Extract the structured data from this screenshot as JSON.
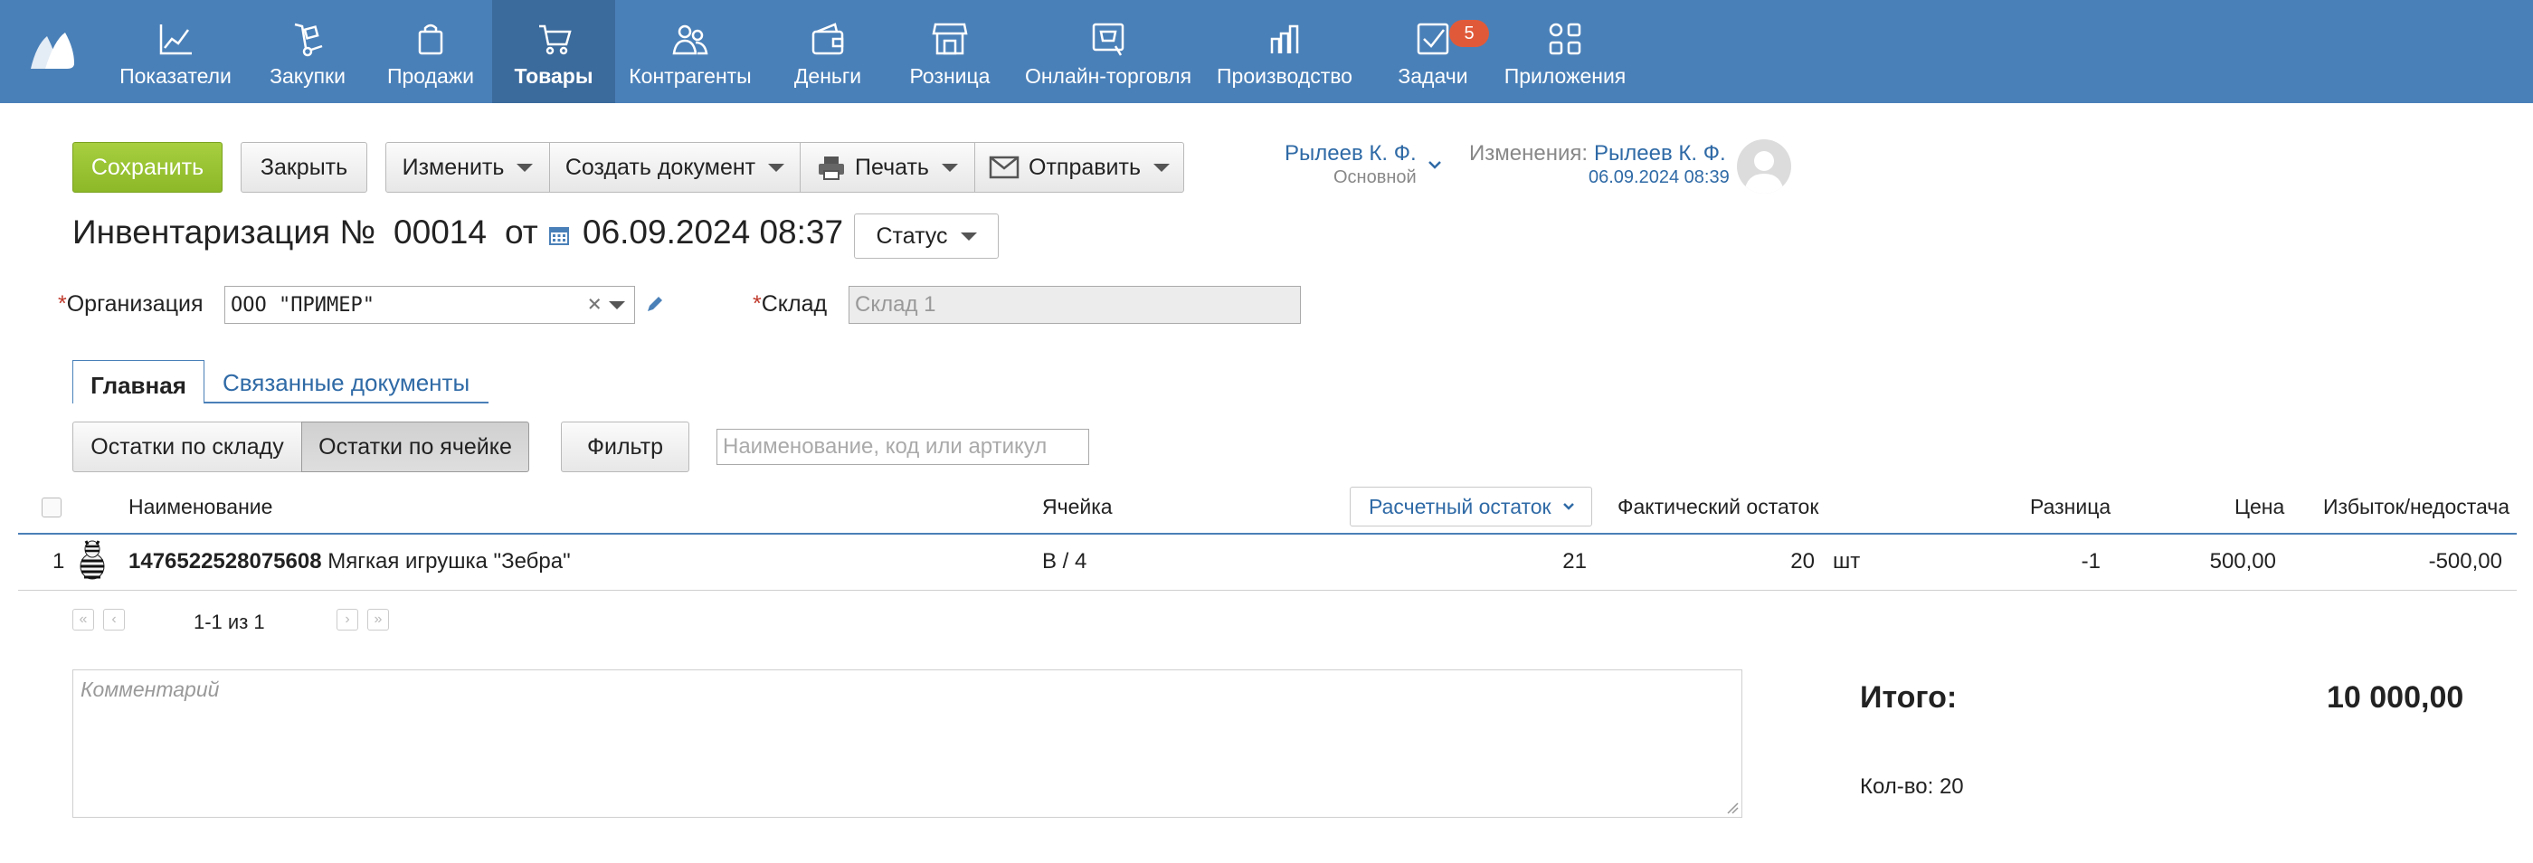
{
  "nav": {
    "items": [
      {
        "label": "Показатели",
        "icon": "chart-line-icon"
      },
      {
        "label": "Закупки",
        "icon": "hand-truck-icon"
      },
      {
        "label": "Продажи",
        "icon": "shopping-bag-icon"
      },
      {
        "label": "Товары",
        "icon": "shopping-cart-icon"
      },
      {
        "label": "Контрагенты",
        "icon": "people-icon"
      },
      {
        "label": "Деньги",
        "icon": "wallet-icon"
      },
      {
        "label": "Розница",
        "icon": "storefront-icon"
      },
      {
        "label": "Онлайн-торговля",
        "icon": "online-store-icon"
      },
      {
        "label": "Производство",
        "icon": "factory-icon"
      },
      {
        "label": "Задачи",
        "icon": "checkbox-icon"
      },
      {
        "label": "Приложения",
        "icon": "apps-grid-icon"
      }
    ],
    "active_index": 3,
    "tasks_badge": "5"
  },
  "toolbar": {
    "save": "Сохранить",
    "close": "Закрыть",
    "edit": "Изменить",
    "create_doc": "Создать документ",
    "print": "Печать",
    "send": "Отправить"
  },
  "owner": {
    "name": "Рылеев К. Ф.",
    "group": "Основной",
    "changes_label": "Изменения:",
    "changes_user": "Рылеев К. Ф.",
    "changes_date": "06.09.2024 08:39"
  },
  "doc": {
    "title": "Инвентаризация №",
    "number": "00014",
    "from": "от",
    "date": "06.09.2024 08:37",
    "status": "Статус"
  },
  "form": {
    "org_label": "Организация",
    "org_value": "ООО \"ПРИМЕР\"",
    "warehouse_label": "Склад",
    "warehouse_placeholder": "Склад 1"
  },
  "tabs": {
    "main": "Главная",
    "related": "Связанные документы"
  },
  "filters": {
    "by_warehouse": "Остатки по складу",
    "by_cell": "Остатки по ячейке",
    "filter": "Фильтр",
    "search_placeholder": "Наименование, код или артикул"
  },
  "table": {
    "headers": {
      "name": "Наименование",
      "cell": "Ячейка",
      "calc": "Расчетный остаток",
      "actual": "Фактический остаток",
      "diff": "Разница",
      "price": "Цена",
      "surplus": "Избыток/недостача"
    },
    "rows": [
      {
        "num": "1",
        "code": "1476522528075608",
        "name": "Мягкая игрушка \"Зебра\"",
        "cell": "В / 4",
        "calc": "21",
        "actual": "20",
        "unit": "шт",
        "diff": "-1",
        "price": "500,00",
        "surplus": "-500,00"
      }
    ]
  },
  "pager": {
    "text": "1-1 из 1"
  },
  "comment_placeholder": "Комментарий",
  "totals": {
    "label": "Итого:",
    "value": "10 000,00",
    "count": "Кол-во: 20"
  },
  "colors": {
    "nav_bg": "#4a80b8",
    "nav_active": "#3b6a9c",
    "save_green": "#8db828",
    "link_blue": "#2f6aa6",
    "badge": "#e05a3a"
  }
}
